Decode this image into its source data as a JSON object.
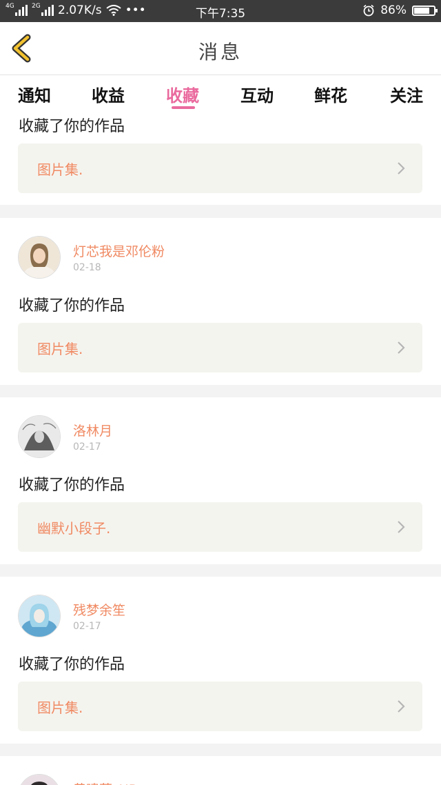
{
  "status_bar": {
    "net_1": "4G",
    "net_2": "2G",
    "speed": "2.07K/s",
    "dots": "•••",
    "time": "下午7:35",
    "battery_pct": "86%",
    "battery_level": 0.86,
    "icons": [
      "signal-icon",
      "signal-icon",
      "wifi-icon",
      "alarm-icon",
      "battery-icon"
    ]
  },
  "header": {
    "title": "消息",
    "back_icon": "chevron-left-icon",
    "accent": "#f2c230"
  },
  "tabs": [
    "通知",
    "收益",
    "收藏",
    "互动",
    "鲜花",
    "关注"
  ],
  "active_tab": 2,
  "accent_color": "#ea6a9e",
  "name_color": "#f08a63",
  "partial_top": {
    "action": "收藏了你的作品",
    "work": "图片集."
  },
  "items": [
    {
      "name": "灯芯我是邓伦粉",
      "date": "02-18",
      "action": "收藏了你的作品",
      "work": "图片集."
    },
    {
      "name": "洛林月",
      "date": "02-17",
      "action": "收藏了你的作品",
      "work": "幽默小段子."
    },
    {
      "name": "残梦余笙",
      "date": "02-17",
      "action": "收藏了你的作品",
      "work": "图片集."
    },
    {
      "name": "黄啸藤_HB",
      "date": "",
      "action": "",
      "work": ""
    }
  ]
}
